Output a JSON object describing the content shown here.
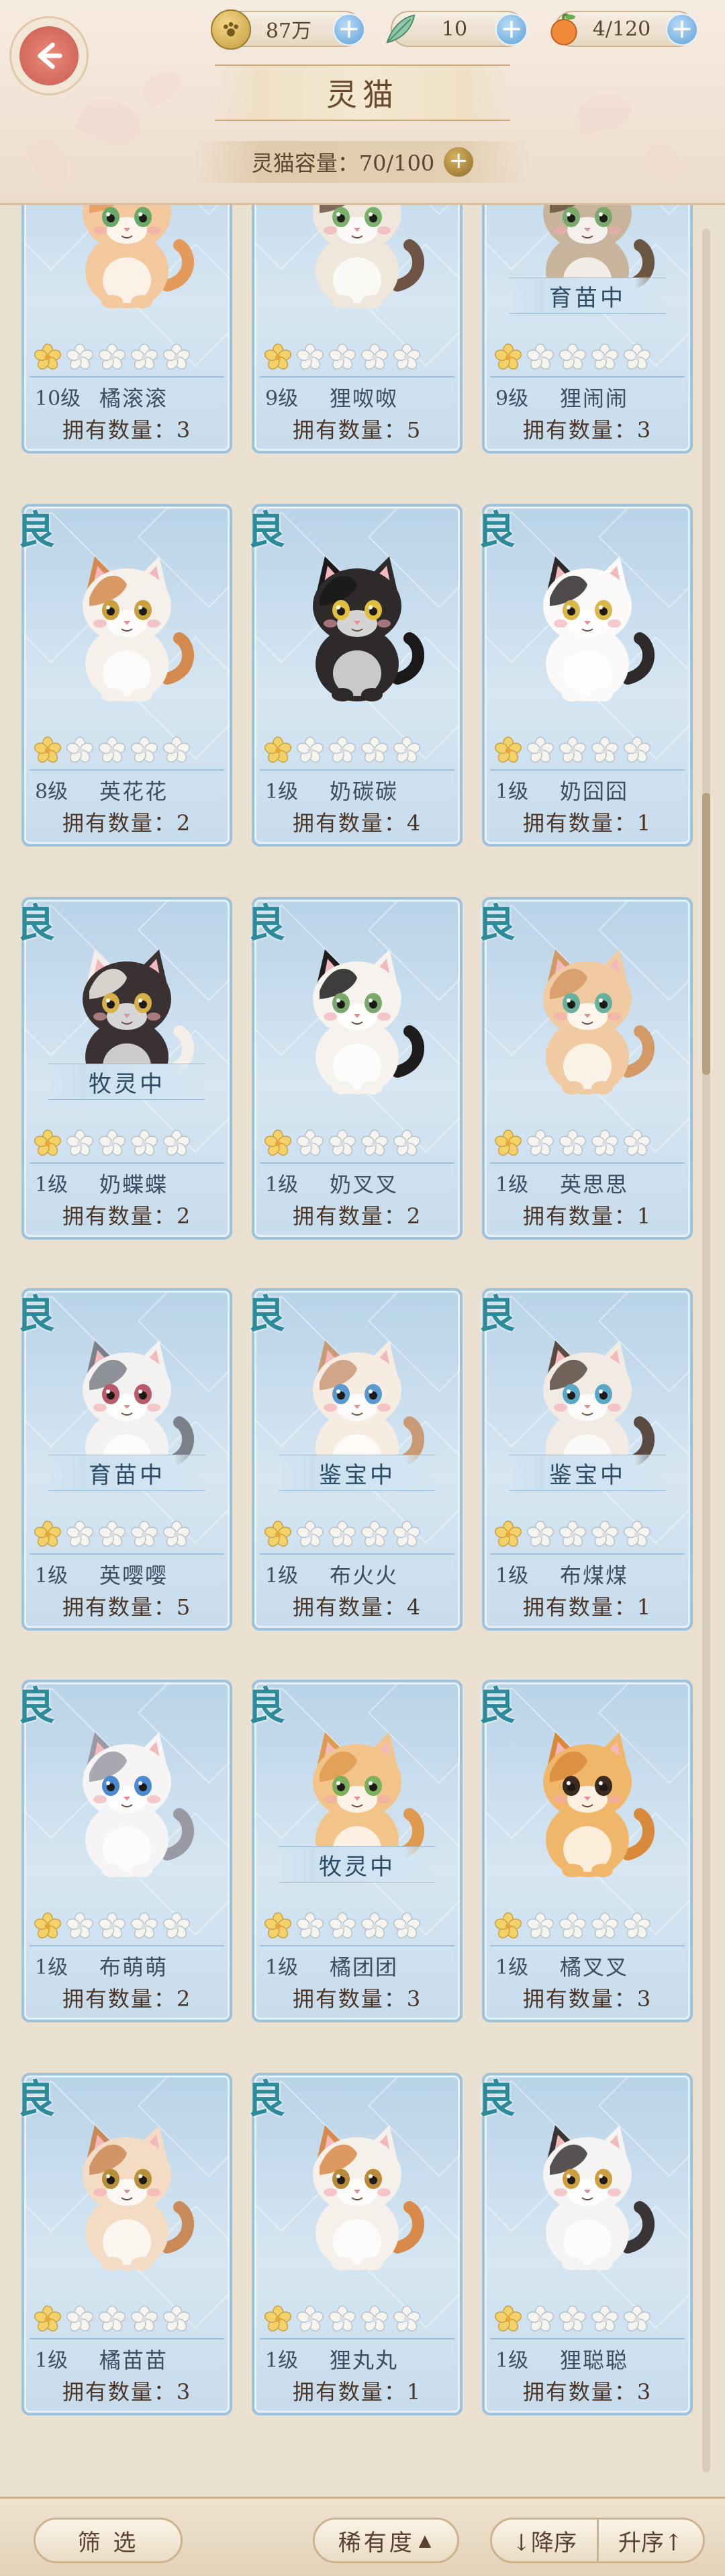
{
  "header": {
    "title": "灵猫",
    "capacity_label": "灵猫容量：70/100",
    "resources": [
      {
        "icon": "paw-coin-icon",
        "value": "87万"
      },
      {
        "icon": "fish-feather-icon",
        "value": "10"
      },
      {
        "icon": "orange-fruit-icon",
        "value": "4/120"
      }
    ]
  },
  "cards": [
    {
      "name": "橘滚滚",
      "level": "10级",
      "owned": "拥有数量：3",
      "rare": "",
      "status": "",
      "stars": 1,
      "fur": "#f3c89c",
      "spot": "#e49a5a",
      "eye": "#6aa86a"
    },
    {
      "name": "狸呶呶",
      "level": "9级",
      "owned": "拥有数量：5",
      "rare": "",
      "status": "",
      "stars": 1,
      "fur": "#efe6dc",
      "spot": "#6e5444",
      "eye": "#7bb06a"
    },
    {
      "name": "狸闹闹",
      "level": "9级",
      "owned": "拥有数量：3",
      "rare": "",
      "status": "育苗中",
      "stars": 1,
      "fur": "#c8b49c",
      "spot": "#6a5442",
      "eye": "#7aa86a"
    },
    {
      "name": "英花花",
      "level": "8级",
      "owned": "拥有数量：2",
      "rare": "良",
      "status": "",
      "stars": 1,
      "fur": "#f6f0ea",
      "spot": "#d48a4e",
      "eye": "#c8a03c"
    },
    {
      "name": "奶碳碳",
      "level": "1级",
      "owned": "拥有数量：4",
      "rare": "良",
      "status": "",
      "stars": 1,
      "fur": "#2e2a2a",
      "spot": "#1a1818",
      "eye": "#e0c040"
    },
    {
      "name": "奶囧囧",
      "level": "1级",
      "owned": "拥有数量：1",
      "rare": "良",
      "status": "",
      "stars": 1,
      "fur": "#fbfaf8",
      "spot": "#2e2a2a",
      "eye": "#d8b84a"
    },
    {
      "name": "奶蝶蝶",
      "level": "1级",
      "owned": "拥有数量：2",
      "rare": "良",
      "status": "牧灵中",
      "stars": 1,
      "fur": "#3a3232",
      "spot": "#f4eee8",
      "eye": "#d8b04a"
    },
    {
      "name": "奶叉叉",
      "level": "1级",
      "owned": "拥有数量：2",
      "rare": "良",
      "status": "",
      "stars": 1,
      "fur": "#f6f2ee",
      "spot": "#1e1c1c",
      "eye": "#7aa86a"
    },
    {
      "name": "英思思",
      "level": "1级",
      "owned": "拥有数量：1",
      "rare": "良",
      "status": "",
      "stars": 1,
      "fur": "#f0caa0",
      "spot": "#d49a66",
      "eye": "#6ab0a0"
    },
    {
      "name": "英嘤嘤",
      "level": "1级",
      "owned": "拥有数量：5",
      "rare": "良",
      "status": "育苗中",
      "stars": 1,
      "fur": "#f4f2f0",
      "spot": "#7c8088",
      "eye": "#b85a6a"
    },
    {
      "name": "布火火",
      "level": "1级",
      "owned": "拥有数量：4",
      "rare": "良",
      "status": "鉴宝中",
      "stars": 1,
      "fur": "#f6ece2",
      "spot": "#c89a76",
      "eye": "#5a9ad0"
    },
    {
      "name": "布煤煤",
      "level": "1级",
      "owned": "拥有数量：1",
      "rare": "良",
      "status": "鉴宝中",
      "stars": 1,
      "fur": "#f2ebe4",
      "spot": "#5a4a42",
      "eye": "#5aa8c8"
    },
    {
      "name": "布萌萌",
      "level": "1级",
      "owned": "拥有数量：2",
      "rare": "良",
      "status": "",
      "stars": 1,
      "fur": "#f6f4f4",
      "spot": "#9a9aa4",
      "eye": "#4a8ad0"
    },
    {
      "name": "橘团团",
      "level": "1级",
      "owned": "拥有数量：3",
      "rare": "良",
      "status": "牧灵中",
      "stars": 1,
      "fur": "#f2c48a",
      "spot": "#e09a4e",
      "eye": "#7ab05a"
    },
    {
      "name": "橘叉叉",
      "level": "1级",
      "owned": "拥有数量：3",
      "rare": "良",
      "status": "",
      "stars": 1,
      "fur": "#f0b66a",
      "spot": "#d88a3a",
      "eye": "#3a2a20"
    },
    {
      "name": "橘苗苗",
      "level": "1级",
      "owned": "拥有数量：3",
      "rare": "良",
      "status": "",
      "stars": 1,
      "fur": "#f4dcc4",
      "spot": "#c98a58",
      "eye": "#b8903a"
    },
    {
      "name": "狸丸丸",
      "level": "1级",
      "owned": "拥有数量：1",
      "rare": "良",
      "status": "",
      "stars": 1,
      "fur": "#f6f0ea",
      "spot": "#d88a4a",
      "eye": "#b88a3a"
    },
    {
      "name": "狸聪聪",
      "level": "1级",
      "owned": "拥有数量：3",
      "rare": "良",
      "status": "",
      "stars": 1,
      "fur": "#f6f4f2",
      "spot": "#3a3636",
      "eye": "#d0a040"
    }
  ],
  "footer": {
    "filter_label": "筛 选",
    "sort_label": "稀有度",
    "desc_label": "↓降序",
    "asc_label": "升序↑"
  }
}
